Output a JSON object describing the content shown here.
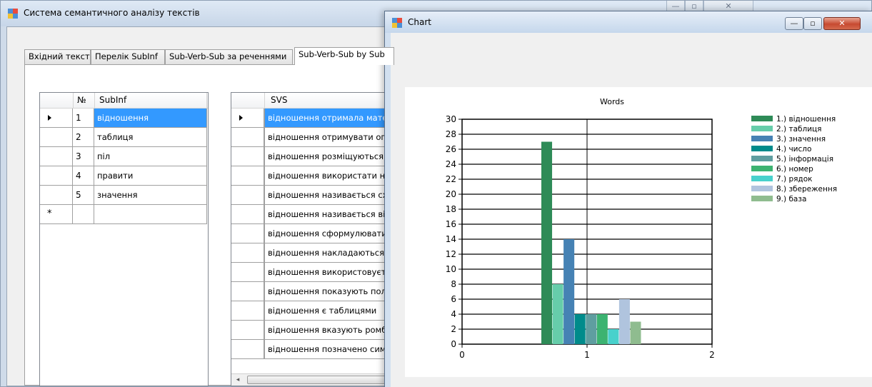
{
  "main_window": {
    "title": "Система семантичного аналізу текстів"
  },
  "tabs": [
    {
      "label": "Вхідний текст"
    },
    {
      "label": "Перелік SubInf"
    },
    {
      "label": "Sub-Verb-Sub за реченнями"
    },
    {
      "label": "Sub-Verb-Sub by Sub"
    }
  ],
  "subinf_grid": {
    "headers": {
      "num": "№",
      "name": "SubInf"
    },
    "rows": [
      {
        "num": "1",
        "name": "відношення"
      },
      {
        "num": "2",
        "name": "таблиця"
      },
      {
        "num": "3",
        "name": "піл"
      },
      {
        "num": "4",
        "name": "правити"
      },
      {
        "num": "5",
        "name": "значення"
      }
    ]
  },
  "svs_grid": {
    "header": "SVS",
    "rows": [
      "відношення отримала матем",
      "відношення отримувати опер",
      "відношення розміщуються та",
      "відношення використати назі",
      "відношення називається схе",
      "відношення називається відн",
      "відношення сформулювати к",
      "відношення накладаються об",
      "відношення використовуєтьс",
      "відношення показують полів",
      "відношення є таблицями",
      "відношення вказують ромба",
      "відношення позначено симво"
    ]
  },
  "chart_window": {
    "title": "Chart"
  },
  "chart_data": {
    "type": "bar",
    "title": "Words",
    "xlabel": "",
    "ylabel": "",
    "xlim": [
      0,
      2
    ],
    "ylim": [
      0,
      30
    ],
    "x_ticks": [
      "0",
      "1",
      "2"
    ],
    "y_ticks": [
      "0",
      "2",
      "4",
      "6",
      "8",
      "10",
      "12",
      "14",
      "16",
      "18",
      "20",
      "22",
      "24",
      "26",
      "28",
      "30"
    ],
    "grid": true,
    "legend_position": "right",
    "series": [
      {
        "name": "1.) відношення",
        "value": 27,
        "color": "#2e8b57"
      },
      {
        "name": "2.) таблиця",
        "value": 8,
        "color": "#66cdaa"
      },
      {
        "name": "3.) значення",
        "value": 14,
        "color": "#4682b4"
      },
      {
        "name": "4.) число",
        "value": 4,
        "color": "#008b8b"
      },
      {
        "name": "5.) інформація",
        "value": 4,
        "color": "#5f9ea0"
      },
      {
        "name": "6.) номер",
        "value": 4,
        "color": "#3cb371"
      },
      {
        "name": "7.) рядок",
        "value": 2,
        "color": "#48d1cc"
      },
      {
        "name": "8.) збереження",
        "value": 6,
        "color": "#b0c4de"
      },
      {
        "name": "9.) база",
        "value": 3,
        "color": "#8fbc8f"
      }
    ]
  }
}
